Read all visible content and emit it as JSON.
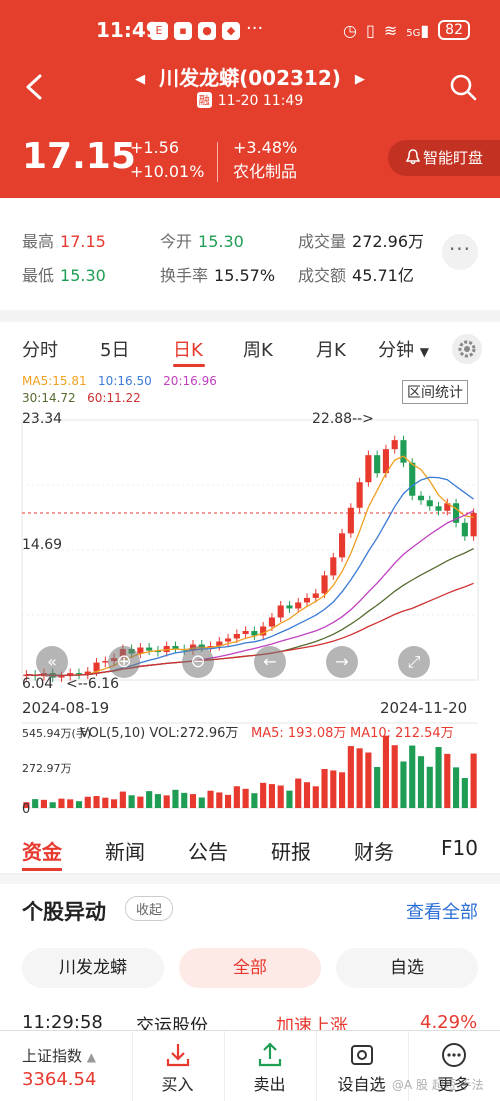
{
  "status_bar": {
    "time": "11:49",
    "network": "5G",
    "battery": "82"
  },
  "header": {
    "title": "川发龙蟒(002312)",
    "badge": "融",
    "datetime": "11-20 11:49",
    "price": "17.15",
    "change": "+1.56",
    "change_pct": "+10.01%",
    "sector_change": "+3.48%",
    "sector": "农化制品",
    "watch_label": "智能盯盘"
  },
  "stats": {
    "high_label": "最高",
    "high": "17.15",
    "low_label": "最低",
    "low": "15.30",
    "open_label": "今开",
    "open": "15.30",
    "turnover_label": "换手率",
    "turnover": "15.57%",
    "volume_label": "成交量",
    "volume": "272.96万",
    "amount_label": "成交额",
    "amount": "45.71亿"
  },
  "period_tabs": [
    "分时",
    "5日",
    "日K",
    "周K",
    "月K",
    "分钟"
  ],
  "active_period": "日K",
  "ma_legend": {
    "ma5": "MA5:15.81",
    "ma10": "10:16.50",
    "ma20": "20:16.96",
    "ma30": "30:14.72",
    "ma60": "60:11.22",
    "colors": {
      "ma5": "#f0a020",
      "ma10": "#3a7bd5",
      "ma20": "#c040c0",
      "ma30": "#556b2f",
      "ma60": "#d03030"
    }
  },
  "range_button": "区间统计",
  "chart_data": {
    "type": "candlestick",
    "y_max_label": "23.34",
    "y_mid_label": "14.69",
    "y_min_label": "6.04",
    "max_annotation": "22.88-->",
    "min_annotation": "<--6.16",
    "x_start": "2024-08-19",
    "x_end": "2024-11-20",
    "closes": [
      6.4,
      6.3,
      6.5,
      6.2,
      6.3,
      6.5,
      6.4,
      6.6,
      7.2,
      7.3,
      7.5,
      8.1,
      7.8,
      8.2,
      8.0,
      7.9,
      8.3,
      8.1,
      8.0,
      8.4,
      8.2,
      8.3,
      8.6,
      8.8,
      9.1,
      9.3,
      9.0,
      9.6,
      10.2,
      11.0,
      10.8,
      11.2,
      11.5,
      11.8,
      13.0,
      14.2,
      15.8,
      17.5,
      19.2,
      21.0,
      19.8,
      21.4,
      22.0,
      20.5,
      18.3,
      18.0,
      17.6,
      17.3,
      17.8,
      16.5,
      15.6,
      17.15
    ],
    "volume_label": "VOL(5,10) VOL:272.96万",
    "vol_ma5": "MA5: 193.08万",
    "vol_ma10": "MA10: 212.54万",
    "vol_top": "545.94万(手)",
    "vol_mid": "272.97万",
    "vol_zero": "0"
  },
  "chart_controls": [
    "zoom-out",
    "zoom-in",
    "zoom-minus",
    "scroll-left",
    "scroll-right",
    "fullscreen"
  ],
  "news_tabs": [
    "资金",
    "新闻",
    "公告",
    "研报",
    "财务",
    "F10"
  ],
  "section": {
    "title": "个股异动",
    "collapse": "收起",
    "see_all": "查看全部",
    "filters": [
      "川发龙蟒",
      "全部",
      "自选"
    ]
  },
  "row": {
    "time": "11:29:58",
    "stock": "交运股份",
    "event": "加速上涨",
    "pct": "4.29%"
  },
  "toolbar": {
    "index_name": "上证指数",
    "index_value": "3364.54",
    "buy": "买入",
    "sell": "卖出",
    "watchlist": "设自选",
    "more": "更多"
  },
  "watermark": "@A 股 超短 手法"
}
